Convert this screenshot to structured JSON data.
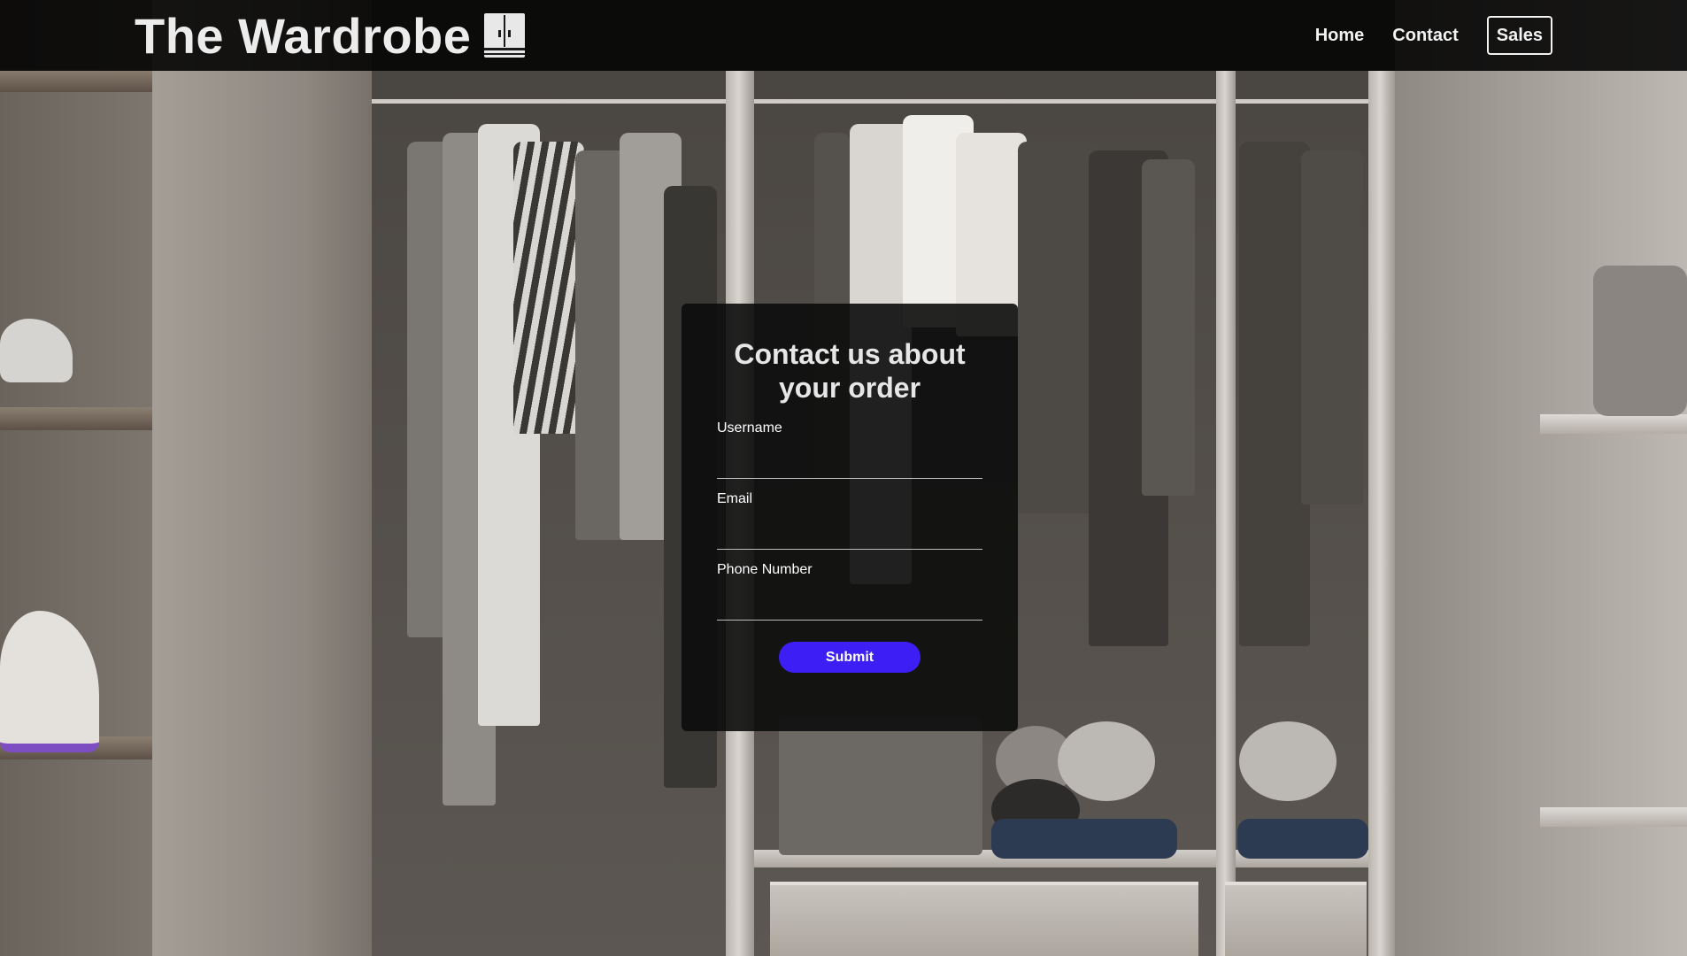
{
  "nav": {
    "brand": "The Wardrobe",
    "brand_icon": "wardrobe-icon",
    "links": {
      "home": "Home",
      "contact": "Contact",
      "sales": "Sales"
    }
  },
  "form": {
    "title": "Contact us about your order",
    "fields": {
      "username": {
        "label": "Username",
        "value": ""
      },
      "email": {
        "label": "Email",
        "value": ""
      },
      "phone": {
        "label": "Phone Number",
        "value": ""
      }
    },
    "submit_label": "Submit"
  },
  "colors": {
    "navbar_bg": "#000000",
    "submit_bg": "#3d1ff5",
    "card_bg": "#0c0c0c"
  }
}
